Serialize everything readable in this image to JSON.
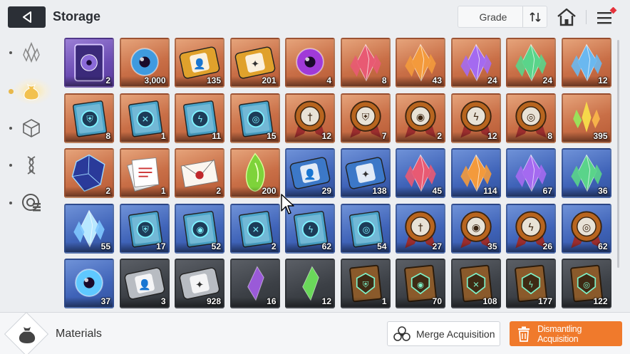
{
  "header": {
    "title": "Storage",
    "grade_label": "Grade"
  },
  "footer": {
    "category_label": "Materials",
    "merge_label": "Merge Acquisition",
    "dismantle_label": "Dismantling Acquisition"
  },
  "colors": {
    "dismantle_accent": "#f07a2c",
    "tile_purple": "#6a4bb2",
    "tile_orange": "#c96f47",
    "tile_blue": "#3f63b8",
    "tile_grey": "#3c4046"
  },
  "rail": {
    "categories": [
      "crystal-cluster-icon",
      "pouch-icon",
      "cube-icon",
      "dna-icon",
      "radar-icon"
    ],
    "active": "pouch-icon"
  },
  "items": [
    {
      "count": "2",
      "bg": "purple",
      "icon": "card-pack-icon"
    },
    {
      "count": "3,000",
      "bg": "orange",
      "icon": "spirit-orb-icon"
    },
    {
      "count": "135",
      "bg": "orange",
      "icon": "gold-ticket-icon"
    },
    {
      "count": "201",
      "bg": "orange",
      "icon": "gold-ticket-star-icon"
    },
    {
      "count": "4",
      "bg": "orange",
      "icon": "eye-orb-icon"
    },
    {
      "count": "8",
      "bg": "orange",
      "icon": "red-crystal-icon"
    },
    {
      "count": "43",
      "bg": "orange",
      "icon": "orange-crystal-icon"
    },
    {
      "count": "24",
      "bg": "orange",
      "icon": "purple-crystal-icon"
    },
    {
      "count": "24",
      "bg": "orange",
      "icon": "green-crystal-icon"
    },
    {
      "count": "12",
      "bg": "orange",
      "icon": "blue-crystal-icon"
    },
    {
      "count": "8",
      "bg": "orange",
      "icon": "shield-book-icon"
    },
    {
      "count": "1",
      "bg": "orange",
      "icon": "cross-book-icon"
    },
    {
      "count": "11",
      "bg": "orange",
      "icon": "bolt-book-icon"
    },
    {
      "count": "15",
      "bg": "orange",
      "icon": "target-book-icon"
    },
    {
      "count": "12",
      "bg": "orange",
      "icon": "sword-medal-icon"
    },
    {
      "count": "7",
      "bg": "orange",
      "icon": "shield-medal-icon"
    },
    {
      "count": "2",
      "bg": "orange",
      "icon": "eye-medal-icon"
    },
    {
      "count": "12",
      "bg": "orange",
      "icon": "bolt-medal-icon"
    },
    {
      "count": "8",
      "bg": "orange",
      "icon": "target-medal-icon"
    },
    {
      "count": "395",
      "bg": "orange",
      "icon": "gold-shard-icon"
    },
    {
      "count": "2",
      "bg": "orange",
      "icon": "blue-cube-icon"
    },
    {
      "count": "1",
      "bg": "orange",
      "icon": "paper-stack-icon"
    },
    {
      "count": "2",
      "bg": "orange",
      "icon": "envelope-icon"
    },
    {
      "count": "200",
      "bg": "orange",
      "icon": "green-flame-icon"
    },
    {
      "count": "29",
      "bg": "blue",
      "icon": "blue-ticket-icon"
    },
    {
      "count": "138",
      "bg": "blue",
      "icon": "blue-ticket-star-icon"
    },
    {
      "count": "45",
      "bg": "blue",
      "icon": "red-crystal-icon"
    },
    {
      "count": "114",
      "bg": "blue",
      "icon": "orange-crystal-icon"
    },
    {
      "count": "67",
      "bg": "blue",
      "icon": "purple-crystal-icon"
    },
    {
      "count": "36",
      "bg": "blue",
      "icon": "green-crystal-icon"
    },
    {
      "count": "55",
      "bg": "blue",
      "icon": "ice-crystal-icon"
    },
    {
      "count": "17",
      "bg": "blue",
      "icon": "shield-book-icon"
    },
    {
      "count": "52",
      "bg": "blue",
      "icon": "eye-book-icon"
    },
    {
      "count": "2",
      "bg": "blue",
      "icon": "cross-book-icon"
    },
    {
      "count": "62",
      "bg": "blue",
      "icon": "bolt-book-icon"
    },
    {
      "count": "54",
      "bg": "blue",
      "icon": "target-book-icon"
    },
    {
      "count": "27",
      "bg": "blue",
      "icon": "sword-medal-icon"
    },
    {
      "count": "35",
      "bg": "blue",
      "icon": "eye-medal-icon"
    },
    {
      "count": "26",
      "bg": "blue",
      "icon": "bolt-medal-icon"
    },
    {
      "count": "62",
      "bg": "blue",
      "icon": "target-medal-icon"
    },
    {
      "count": "37",
      "bg": "blue",
      "icon": "ice-orb-icon"
    },
    {
      "count": "3",
      "bg": "grey",
      "icon": "silver-ticket-icon"
    },
    {
      "count": "928",
      "bg": "grey",
      "icon": "silver-ticket-star-icon"
    },
    {
      "count": "16",
      "bg": "grey",
      "icon": "purple-shard-icon"
    },
    {
      "count": "12",
      "bg": "grey",
      "icon": "green-shard-icon"
    },
    {
      "count": "1",
      "bg": "grey",
      "icon": "shield-tome-icon"
    },
    {
      "count": "70",
      "bg": "grey",
      "icon": "eye-tome-icon"
    },
    {
      "count": "108",
      "bg": "grey",
      "icon": "cross-tome-icon"
    },
    {
      "count": "177",
      "bg": "grey",
      "icon": "bolt-tome-icon"
    },
    {
      "count": "122",
      "bg": "grey",
      "icon": "target-tome-icon"
    }
  ]
}
